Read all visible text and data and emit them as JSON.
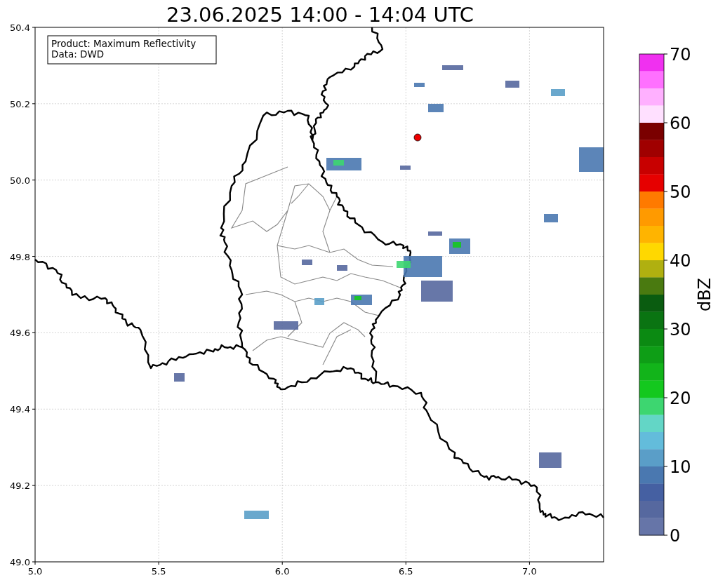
{
  "title": "23.06.2025 14:00 - 14:04 UTC",
  "map": {
    "legend": [
      "Product: Maximum Reflectivity",
      "Data: DWD"
    ],
    "x_ticks": [
      "5.0",
      "5.5",
      "6.0",
      "6.5",
      "7.0"
    ],
    "y_ticks": [
      "50.4",
      "50.2",
      "50.0",
      "49.8",
      "49.6",
      "49.4",
      "49.2",
      "49.0"
    ]
  },
  "colorbar": {
    "label": "dBZ",
    "ticks": [
      "70",
      "60",
      "50",
      "40",
      "30",
      "20",
      "10",
      "0"
    ],
    "bands": [
      {
        "color": "#f030f0"
      },
      {
        "color": "#ff70ff"
      },
      {
        "color": "#ffb0ff"
      },
      {
        "color": "#ffe0ff"
      },
      {
        "color": "#7a0000"
      },
      {
        "color": "#a00000"
      },
      {
        "color": "#c80000"
      },
      {
        "color": "#e60000"
      },
      {
        "color": "#ff7a00"
      },
      {
        "color": "#ff9a00"
      },
      {
        "color": "#ffb400"
      },
      {
        "color": "#ffd800"
      },
      {
        "color": "#b0b010"
      },
      {
        "color": "#4a7a10"
      },
      {
        "color": "#0a5c10"
      },
      {
        "color": "#0a7412"
      },
      {
        "color": "#0b8a12"
      },
      {
        "color": "#0e9e16"
      },
      {
        "color": "#12b41a"
      },
      {
        "color": "#14c81e"
      },
      {
        "color": "#3dd670"
      },
      {
        "color": "#63d6c6"
      },
      {
        "color": "#63bcdb"
      },
      {
        "color": "#5a9ec8"
      },
      {
        "color": "#4a78b0"
      },
      {
        "color": "#4560a2"
      },
      {
        "color": "#56689f"
      },
      {
        "color": "#6675a8"
      }
    ]
  }
}
